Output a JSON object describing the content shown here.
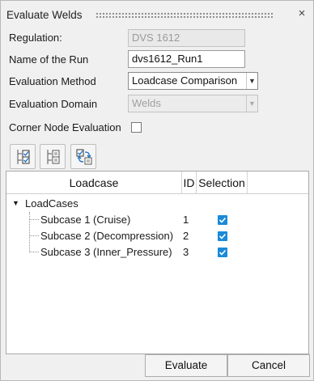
{
  "dialog": {
    "title": "Evaluate Welds",
    "close_glyph": "×"
  },
  "form": {
    "regulation_label": "Regulation:",
    "regulation_value": "DVS 1612",
    "run_name_label": "Name of the Run",
    "run_name_value": "dvs1612_Run1",
    "method_label": "Evaluation Method",
    "method_value": "Loadcase Comparison",
    "domain_label": "Evaluation Domain",
    "domain_value": "Welds",
    "corner_label": "Corner Node Evaluation",
    "corner_checked": false
  },
  "toolbar": {
    "icons": [
      "check-all-icon",
      "uncheck-all-icon",
      "swap-selection-icon"
    ]
  },
  "table": {
    "columns": [
      "Loadcase",
      "ID",
      "Selection"
    ],
    "root_label": "LoadCases",
    "rows": [
      {
        "name": "Subcase 1 (Cruise)",
        "id": "1",
        "selected": true
      },
      {
        "name": "Subcase 2 (Decompression)",
        "id": "2",
        "selected": true
      },
      {
        "name": "Subcase 3 (Inner_Pressure)",
        "id": "3",
        "selected": true
      }
    ]
  },
  "footer": {
    "evaluate_label": "Evaluate",
    "cancel_label": "Cancel"
  },
  "colors": {
    "accent": "#1a8ad9",
    "background": "#f0f0f0"
  }
}
